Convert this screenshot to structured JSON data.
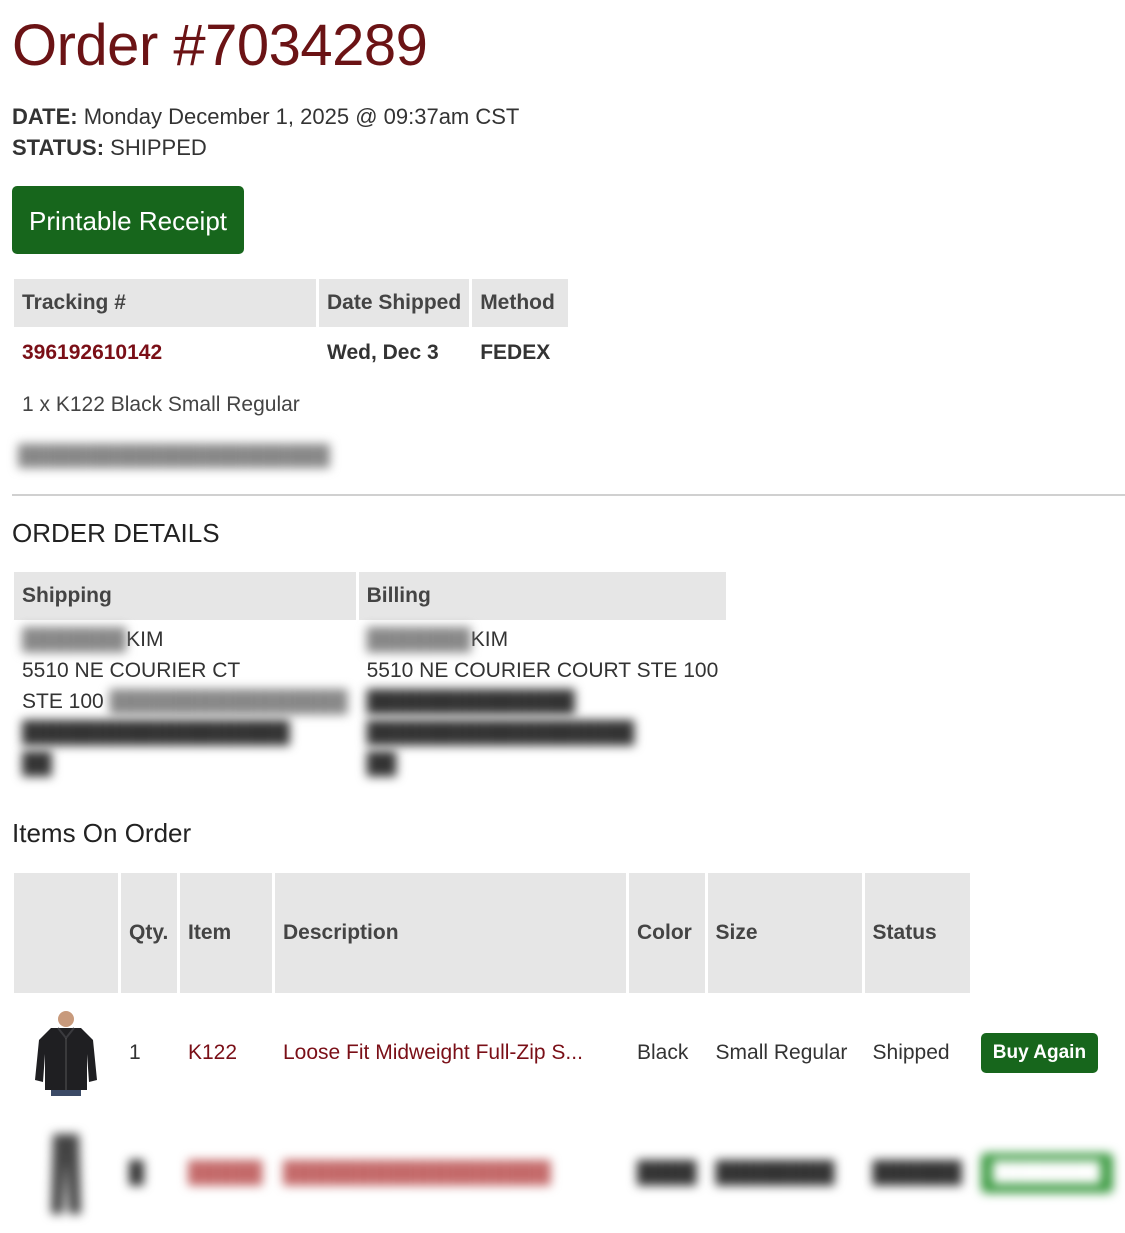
{
  "order": {
    "title": "Order #7034289",
    "date_label": "DATE:",
    "date_value": " Monday December 1, 2025 @ 09:37am CST",
    "status_label": "STATUS:",
    "status_value": " SHIPPED",
    "receipt_button": "Printable Receipt"
  },
  "shipments": {
    "headers": [
      "Tracking #",
      "Date Shipped",
      "Method"
    ],
    "tracking_number": "396192610142",
    "date_shipped": "Wed, Dec 3",
    "method": "FEDEX",
    "items_text": "1 x K122 Black Small Regular"
  },
  "details": {
    "title": "ORDER DETAILS",
    "shipping_header": "Shipping",
    "billing_header": "Billing",
    "shipping": {
      "name": "KIM",
      "line1": "5510 NE COURIER CT",
      "line2": "STE 100"
    },
    "billing": {
      "name": "KIM",
      "line1": "5510 NE COURIER COURT STE 100"
    }
  },
  "items": {
    "title": "Items On Order",
    "headers": [
      "",
      "Qty.",
      "Item",
      "Description",
      "Color",
      "Size",
      "Status"
    ],
    "rows": [
      {
        "qty": "1",
        "item": "K122",
        "description": "Loose Fit Midweight Full-Zip S...",
        "color": "Black",
        "size": "Small Regular",
        "status": "Shipped",
        "action": "Buy Again"
      }
    ]
  },
  "colors": {
    "brand_maroon": "#6b1315",
    "link_red": "#7a0f17",
    "button_green": "#17661c",
    "header_gray": "#e6e6e6"
  }
}
